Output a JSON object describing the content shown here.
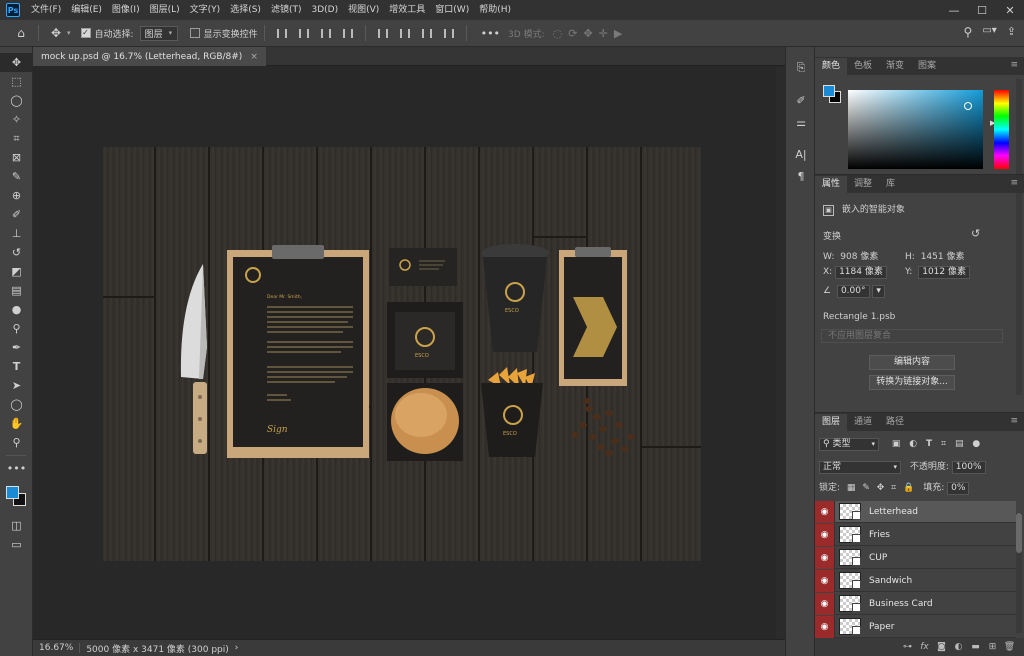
{
  "menubar": {
    "logo": "Ps",
    "items": [
      "文件(F)",
      "编辑(E)",
      "图像(I)",
      "图层(L)",
      "文字(Y)",
      "选择(S)",
      "滤镜(T)",
      "3D(D)",
      "视图(V)",
      "增效工具",
      "窗口(W)",
      "帮助(H)"
    ],
    "window_controls": {
      "minimize": "—",
      "maximize": "☐",
      "close": "✕"
    }
  },
  "options": {
    "auto_select_label": "自动选择:",
    "auto_select_checked": true,
    "layer_select": "图层",
    "show_transform_label": "显示变换控件",
    "mode_3d_label": "3D 模式:",
    "more": "•••"
  },
  "document": {
    "tab_title": "mock up.psd @ 16.7% (Letterhead, RGB/8#)",
    "tab_close": "×"
  },
  "artwork": {
    "letter_greeting": "Dear Mr. Smith,",
    "cup_brand": "ESCO",
    "box_brand": "ESCO",
    "fries_brand": "ESCO",
    "signature": "Sign"
  },
  "status": {
    "zoom": "16.67%",
    "doc_info": "5000 像素 x 3471 像素 (300 ppi)",
    "arrow": "›"
  },
  "colors": {
    "foreground": "#1a8ad4",
    "background": "#111111",
    "hue": "#139bd8"
  },
  "color_panel": {
    "tabs": [
      "颜色",
      "色板",
      "渐变",
      "图案"
    ],
    "menu": "≡"
  },
  "properties_panel": {
    "tabs": [
      "属性",
      "调整",
      "库"
    ],
    "menu": "≡",
    "object_type": "嵌入的智能对象",
    "section_transform": "变换",
    "reset_icon": "↺",
    "w_label": "W:",
    "w_value": "908 像素",
    "h_label": "H:",
    "h_value": "1451 像素",
    "x_label": "X:",
    "x_value": "1184 像素",
    "y_label": "Y:",
    "y_value": "1012 像素",
    "angle_label": "∠",
    "angle_value": "0.00°",
    "source_name": "Rectangle 1.psb",
    "comp_placeholder": "不应用图层复合",
    "edit_button": "编辑内容",
    "convert_button": "转换为链接对象..."
  },
  "layers_panel": {
    "tabs": [
      "图层",
      "通道",
      "路径"
    ],
    "menu": "≡",
    "filter_kind": "类型",
    "blend_mode": "正常",
    "opacity_label": "不透明度:",
    "opacity_value": "100%",
    "lock_label": "锁定:",
    "fill_label": "填充:",
    "fill_value": "0%",
    "layers": [
      {
        "name": "Letterhead",
        "selected": true
      },
      {
        "name": "Fries",
        "selected": false
      },
      {
        "name": "CUP",
        "selected": false
      },
      {
        "name": "Sandwich",
        "selected": false
      },
      {
        "name": "Business Card",
        "selected": false
      },
      {
        "name": "Paper",
        "selected": false
      }
    ],
    "footer_icons": [
      "link-icon",
      "fx-icon",
      "mask-icon",
      "adjustment-icon",
      "folder-icon",
      "new-layer-icon",
      "trash-icon"
    ]
  }
}
